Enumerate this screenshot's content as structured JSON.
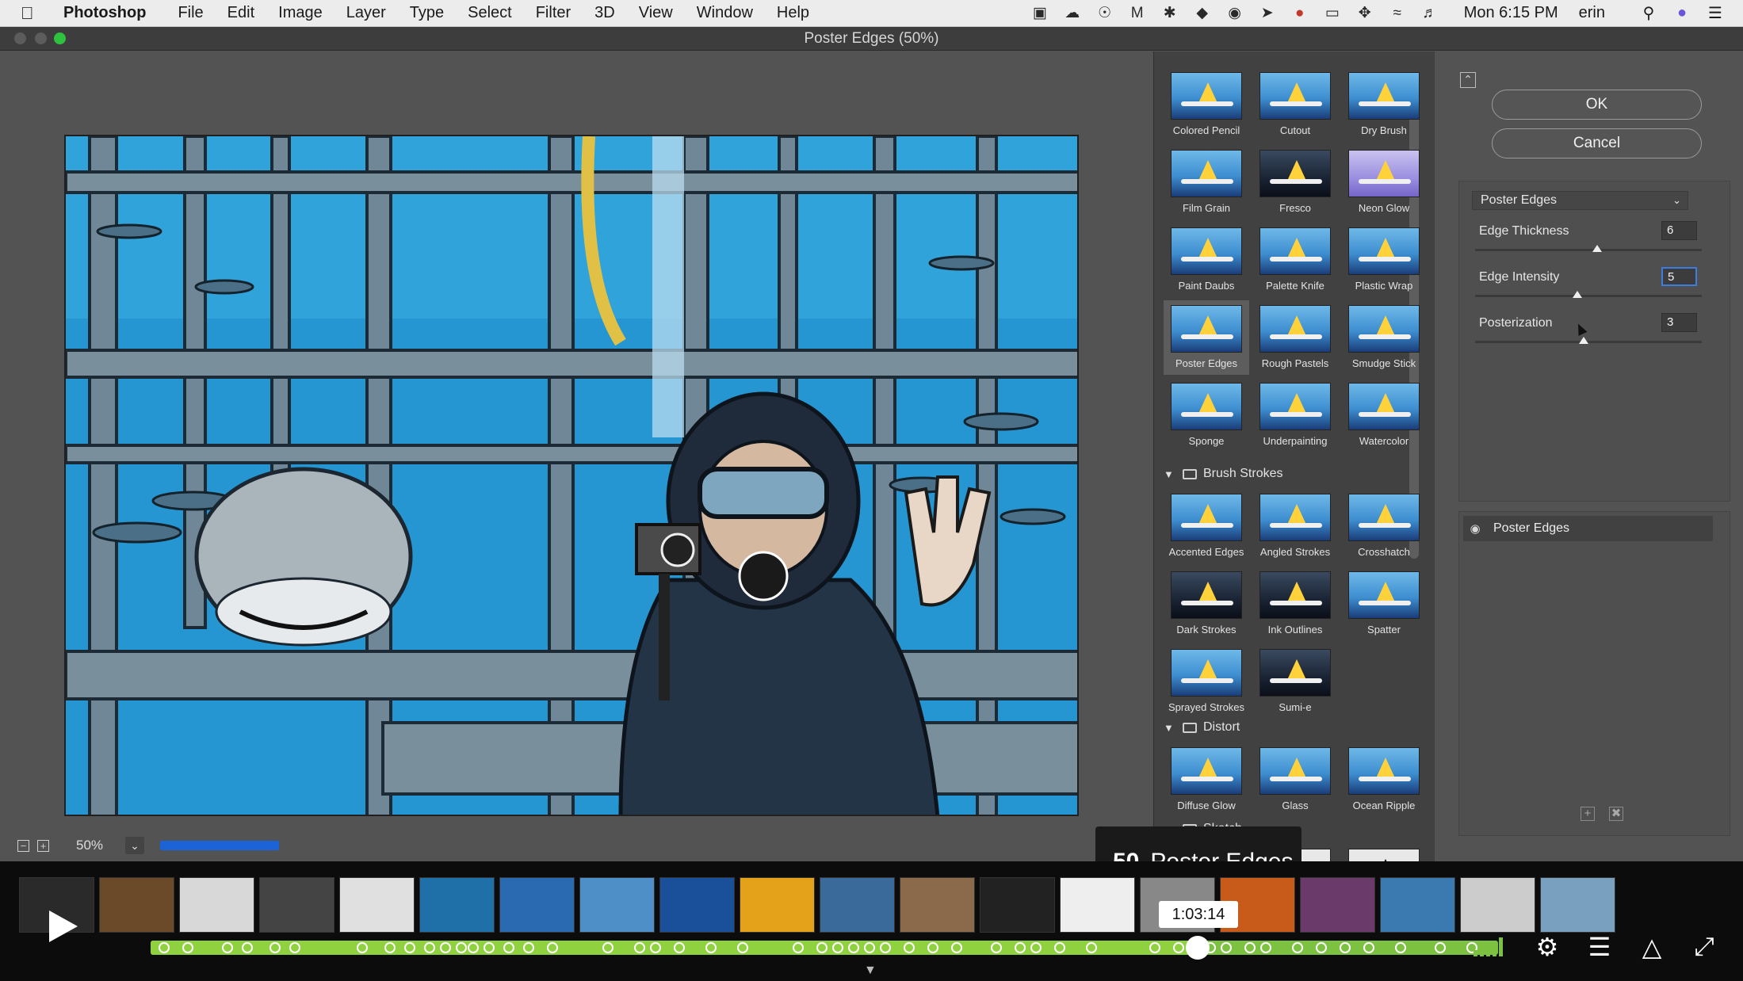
{
  "menubar": {
    "app": "Photoshop",
    "menus": [
      "File",
      "Edit",
      "Image",
      "Layer",
      "Type",
      "Select",
      "Filter",
      "3D",
      "View",
      "Window",
      "Help"
    ],
    "clock": "Mon 6:15 PM",
    "user": "erin"
  },
  "window": {
    "title": "Poster Edges (50%)"
  },
  "preview": {
    "zoom": "50%"
  },
  "gallery": {
    "artistic": [
      "Colored Pencil",
      "Cutout",
      "Dry Brush",
      "Film Grain",
      "Fresco",
      "Neon Glow",
      "Paint Daubs",
      "Palette Knife",
      "Plastic Wrap",
      "Poster Edges",
      "Rough Pastels",
      "Smudge Stick",
      "Sponge",
      "Underpainting",
      "Watercolor"
    ],
    "brush_strokes": {
      "title": "Brush Strokes",
      "items": [
        "Accented Edges",
        "Angled Strokes",
        "Crosshatch",
        "Dark Strokes",
        "Ink Outlines",
        "Spatter",
        "Sprayed Strokes",
        "Sumi-e"
      ]
    },
    "distort": {
      "title": "Distort",
      "items": [
        "Diffuse Glow",
        "Glass",
        "Ocean Ripple"
      ]
    },
    "sketch": {
      "title": "Sketch"
    },
    "selected": "Poster Edges"
  },
  "settings": {
    "ok": "OK",
    "cancel": "Cancel",
    "filter": "Poster Edges",
    "params": [
      {
        "label": "Edge Thickness",
        "value": "6",
        "fraction": 0.54
      },
      {
        "label": "Edge Intensity",
        "value": "5",
        "fraction": 0.45
      },
      {
        "label": "Posterization",
        "value": "3",
        "fraction": 0.48
      }
    ],
    "layer": "Poster Edges"
  },
  "player": {
    "chapter_num": "50",
    "chapter_title": "Poster Edges",
    "time": "1:03:14",
    "progress": 0.78
  },
  "colors": {
    "accent": "#7cc13f",
    "selection": "#3d7de0",
    "ocean": "#2a9cd7"
  }
}
